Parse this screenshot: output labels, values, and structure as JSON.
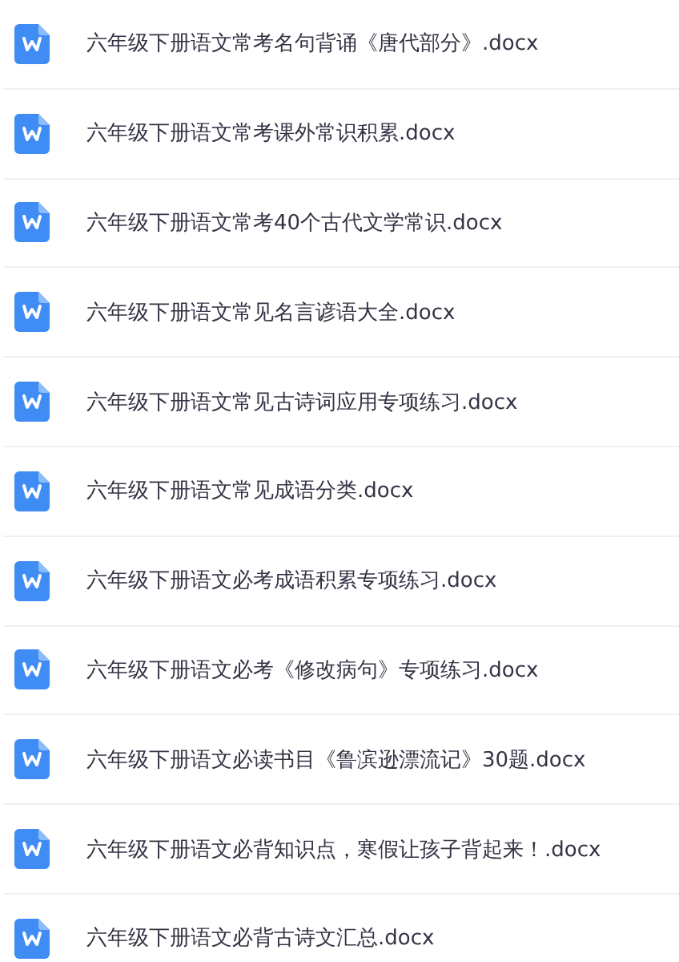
{
  "files": [
    {
      "name": "六年级下册语文常考名句背诵《唐代部分》.docx"
    },
    {
      "name": "六年级下册语文常考课外常识积累.docx"
    },
    {
      "name": "六年级下册语文常考40个古代文学常识.docx"
    },
    {
      "name": "六年级下册语文常见名言谚语大全.docx"
    },
    {
      "name": "六年级下册语文常见古诗词应用专项练习.docx"
    },
    {
      "name": "六年级下册语文常见成语分类.docx"
    },
    {
      "name": "六年级下册语文必考成语积累专项练习.docx"
    },
    {
      "name": "六年级下册语文必考《修改病句》专项练习.docx"
    },
    {
      "name": "六年级下册语文必读书目《鲁滨逊漂流记》30题.docx"
    },
    {
      "name": "六年级下册语文必背知识点，寒假让孩子背起来！.docx"
    },
    {
      "name": "六年级下册语文必背古诗文汇总.docx"
    }
  ]
}
